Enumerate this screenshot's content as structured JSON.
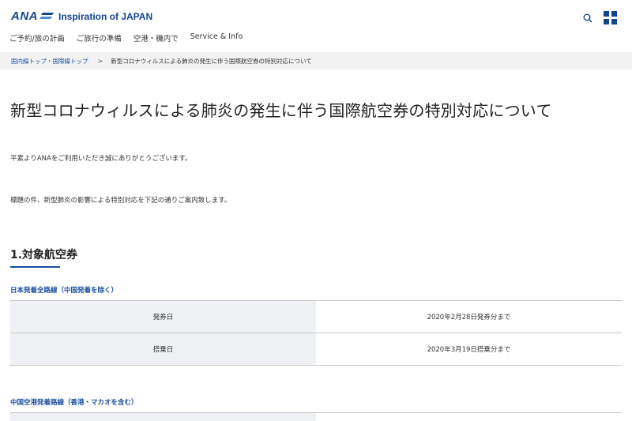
{
  "header": {
    "logo_text": "ANA",
    "tagline": "Inspiration of JAPAN",
    "brand_color": "#13448f",
    "icons": [
      "search-icon",
      "menu-grid-icon"
    ]
  },
  "nav": {
    "items": [
      {
        "label": "ご予約/旅の計画"
      },
      {
        "label": "ご旅行の準備"
      },
      {
        "label": "空港・機内で"
      },
      {
        "label": "Service & Info"
      }
    ]
  },
  "breadcrumb": {
    "link": "国内線トップ・国際線トップ",
    "separator": ">",
    "current": "新型コロナウィルスによる肺炎の発生に伴う国際航空券の特別対応について"
  },
  "main": {
    "title": "新型コロナウィルスによる肺炎の発生に伴う国際航空券の特別対応について",
    "paragraph1": "平素よりANAをご利用いただき誠にありがとうございます。",
    "paragraph2": "標題の件、新型肺炎の影響による特別対応を下記の通りご案内致します。",
    "section_title": "1.対象航空券",
    "subsections": [
      {
        "heading": "日本発着全路線（中国発着を除く）",
        "rows": [
          {
            "label": "発券日",
            "value": "2020年2月28日発券分まで"
          },
          {
            "label": "搭乗日",
            "value": "2020年3月19日搭乗分まで"
          }
        ]
      },
      {
        "heading": "中国空港発着路線（香港・マカオを含む）",
        "rows": []
      }
    ]
  }
}
